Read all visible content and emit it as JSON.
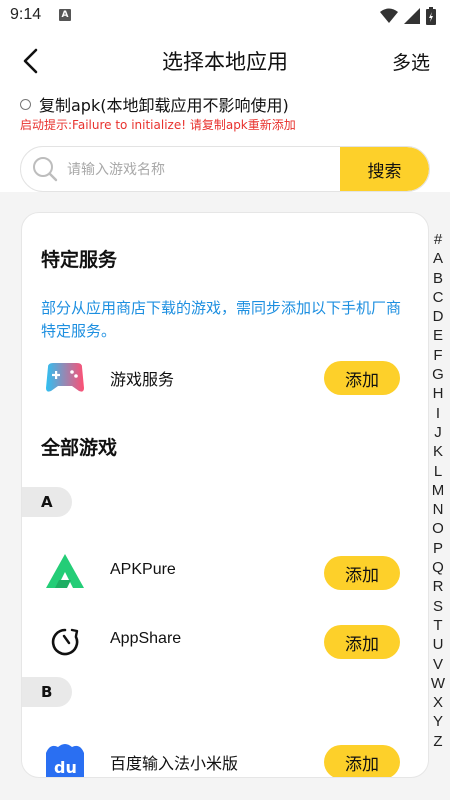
{
  "status_bar": {
    "time": "9:14",
    "notification_badge": "A"
  },
  "header": {
    "title": "选择本地应用",
    "multi_select": "多选"
  },
  "copy_option": {
    "label": "复制apk(本地卸载应用不影响使用)",
    "checked": false
  },
  "warning": "启动提示:Failure to initialize! 请复制apk重新添加",
  "search": {
    "placeholder": "请输入游戏名称",
    "value": "",
    "button_label": "搜索"
  },
  "special_section": {
    "title": "特定服务",
    "notice": "部分从应用商店下载的游戏，需同步添加以下手机厂商特定服务。",
    "items": [
      {
        "name": "游戏服务",
        "icon": "gamepad-icon",
        "add_label": "添加"
      }
    ]
  },
  "all_games": {
    "title": "全部游戏",
    "groups": [
      {
        "letter": "A",
        "apps": [
          {
            "name": "APKPure",
            "icon": "apkpure-logo-icon",
            "add_label": "添加"
          },
          {
            "name": "AppShare",
            "icon": "appshare-logo-icon",
            "add_label": "添加"
          }
        ]
      },
      {
        "letter": "B",
        "apps": [
          {
            "name": "百度输入法小米版",
            "icon": "baidu-input-logo-icon",
            "add_label": "添加"
          }
        ]
      }
    ]
  },
  "index_bar": [
    "#",
    "A",
    "B",
    "C",
    "D",
    "E",
    "F",
    "G",
    "H",
    "I",
    "J",
    "K",
    "L",
    "M",
    "N",
    "O",
    "P",
    "Q",
    "R",
    "S",
    "T",
    "U",
    "V",
    "W",
    "X",
    "Y",
    "Z"
  ],
  "colors": {
    "accent": "#fdd02a",
    "warning": "#e8322e",
    "notice": "#1d8fe0",
    "background": "#f4f4f4"
  }
}
